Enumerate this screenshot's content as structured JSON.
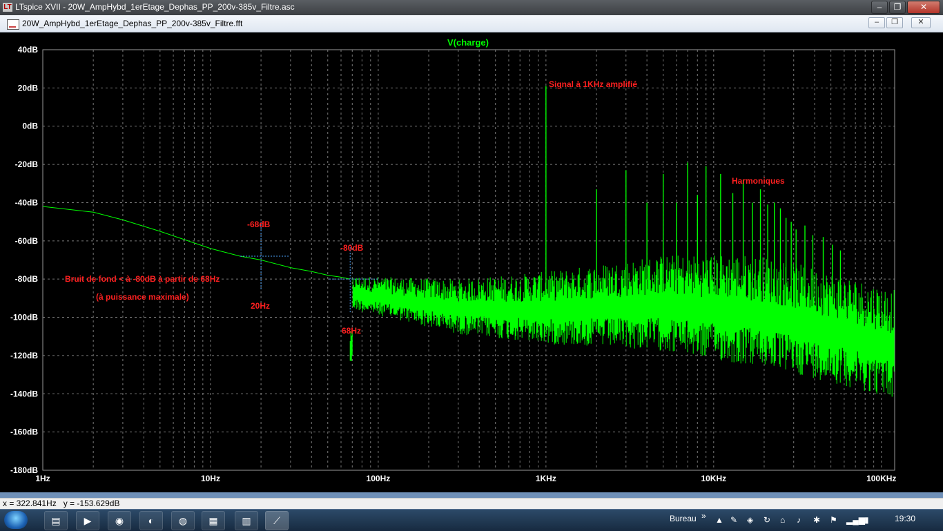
{
  "app": {
    "title": "LTspice XVII - 20W_AmpHybd_1erEtage_Dephas_PP_200v-385v_Filtre.asc",
    "logo": "ltspice-logo"
  },
  "window": {
    "title": "20W_AmpHybd_1erEtage_Dephas_PP_200v-385v_Filtre.fft"
  },
  "status": {
    "cursor_readout": "x = 322.841Hz   y = -153.629dB"
  },
  "taskbar": {
    "bureau_label": "Bureau",
    "time": "19:30",
    "chevron": "»"
  },
  "annotations": {
    "signal": "Signal à 1KHz amplifié",
    "harmoniques": "Harmoniques",
    "m68": "-68dB",
    "m80": "-80dB",
    "hz20": "20Hz",
    "hz68": "68Hz",
    "bruit": "Bruit de fond < à -80dB à partir de 68Hz",
    "puissance": "(à puissance maximale)"
  },
  "colors": {
    "trace": "#00ff00",
    "annotation": "#ff2020",
    "grid": "#7a7a7a",
    "axis_text": "#ffffff",
    "background": "#000000"
  },
  "chart_data": {
    "type": "line",
    "title": "V(charge)",
    "x_scale": "log",
    "xlim": [
      1,
      120000
    ],
    "ylim": [
      -180,
      40
    ],
    "x_ticks": [
      {
        "value": 1,
        "label": "1Hz"
      },
      {
        "value": 10,
        "label": "10Hz"
      },
      {
        "value": 100,
        "label": "100Hz"
      },
      {
        "value": 1000,
        "label": "1KHz"
      },
      {
        "value": 10000,
        "label": "10KHz"
      },
      {
        "value": 100000,
        "label": "100KHz"
      }
    ],
    "y_ticks": [
      {
        "value": 40,
        "label": "40dB"
      },
      {
        "value": 20,
        "label": "20dB"
      },
      {
        "value": 0,
        "label": "0dB"
      },
      {
        "value": -20,
        "label": "-20dB"
      },
      {
        "value": -40,
        "label": "-40dB"
      },
      {
        "value": -60,
        "label": "-60dB"
      },
      {
        "value": -80,
        "label": "-80dB"
      },
      {
        "value": -100,
        "label": "-100dB"
      },
      {
        "value": -120,
        "label": "-120dB"
      },
      {
        "value": -140,
        "label": "-140dB"
      },
      {
        "value": -160,
        "label": "-160dB"
      },
      {
        "value": -180,
        "label": "-180dB"
      }
    ],
    "grid": true,
    "series": [
      {
        "name": "V(charge)",
        "color": "#00ff00",
        "x": [
          1,
          2,
          3,
          5,
          10,
          15,
          20,
          30,
          40,
          50,
          60,
          68
        ],
        "y": [
          -42,
          -45,
          -49,
          -55,
          -64,
          -68,
          -70,
          -74,
          -76,
          -78,
          -79,
          -80
        ],
        "noise_floor_db": [
          [
            70,
            -88
          ],
          [
            300,
            -96
          ],
          [
            1000,
            -97
          ],
          [
            5000,
            -95
          ],
          [
            20000,
            -100
          ],
          [
            50000,
            -108
          ],
          [
            120000,
            -117
          ]
        ],
        "peaks": [
          {
            "x": 1000,
            "y": 21
          },
          {
            "x": 2000,
            "y": -33
          },
          {
            "x": 3000,
            "y": -23
          },
          {
            "x": 4000,
            "y": -40
          },
          {
            "x": 5000,
            "y": -25
          },
          {
            "x": 6000,
            "y": -40
          },
          {
            "x": 7000,
            "y": -19
          },
          {
            "x": 8000,
            "y": -36
          },
          {
            "x": 9000,
            "y": -21
          },
          {
            "x": 11000,
            "y": -25
          },
          {
            "x": 13000,
            "y": -35
          },
          {
            "x": 15000,
            "y": -28
          },
          {
            "x": 17000,
            "y": -40
          },
          {
            "x": 19000,
            "y": -33
          },
          {
            "x": 21000,
            "y": -41
          },
          {
            "x": 23000,
            "y": -40
          },
          {
            "x": 25000,
            "y": -43
          },
          {
            "x": 27000,
            "y": -48
          },
          {
            "x": 29000,
            "y": -50
          },
          {
            "x": 31000,
            "y": -54
          },
          {
            "x": 35000,
            "y": -52
          },
          {
            "x": 39000,
            "y": -57
          },
          {
            "x": 45000,
            "y": -58
          },
          {
            "x": 51000,
            "y": -62
          },
          {
            "x": 57000,
            "y": -65
          }
        ]
      }
    ],
    "markers": [
      {
        "x": 20,
        "y": -68
      },
      {
        "x": 68,
        "y": -80
      }
    ]
  }
}
